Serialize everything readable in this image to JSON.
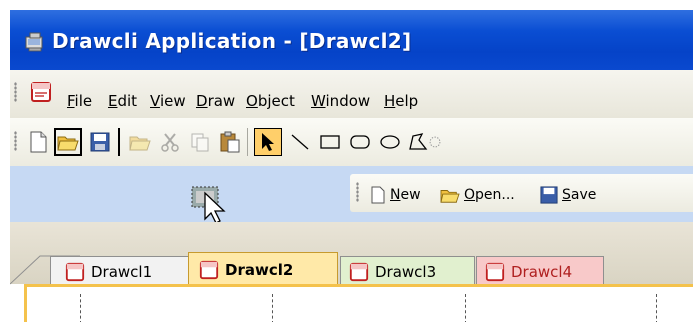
{
  "window": {
    "title": "Drawcli Application - [Drawcl2]"
  },
  "menubar": {
    "items": [
      {
        "label": "File",
        "mnemonic": "F",
        "rest": "ile"
      },
      {
        "label": "Edit",
        "mnemonic": "E",
        "rest": "dit"
      },
      {
        "label": "View",
        "mnemonic": "V",
        "rest": "iew"
      },
      {
        "label": "Draw",
        "mnemonic": "D",
        "rest": "raw"
      },
      {
        "label": "Object",
        "mnemonic": "O",
        "rest": "bject"
      },
      {
        "label": "Window",
        "mnemonic": "W",
        "rest": "indow"
      },
      {
        "label": "Help",
        "mnemonic": "H",
        "rest": "elp"
      }
    ]
  },
  "toolbar": {
    "buttons": [
      "new-icon",
      "open-icon",
      "save-icon",
      "open-icon",
      "cut-icon",
      "copy-icon",
      "paste-icon",
      "select-arrow-icon",
      "line-icon",
      "rectangle-icon",
      "rounded-rectangle-icon",
      "ellipse-icon",
      "polygon-icon"
    ]
  },
  "toolbar2": {
    "new": {
      "mnemonic": "N",
      "rest": "ew"
    },
    "open": {
      "mnemonic": "O",
      "rest": "pen..."
    },
    "save": {
      "mnemonic": "S",
      "rest": "ave"
    }
  },
  "tabs": [
    {
      "label": "Drawcl1",
      "active": false,
      "color": "#f2f2f2"
    },
    {
      "label": "Drawcl2",
      "active": true,
      "color": "#ffe9a8"
    },
    {
      "label": "Drawcl3",
      "active": false,
      "color": "#e1f0cf"
    },
    {
      "label": "Drawcl4",
      "active": false,
      "color": "#f8c9c9"
    }
  ],
  "colors": {
    "titlebar": "#0543c8",
    "accent": "#f4c24c",
    "toolbar_area": "#c6d9f3"
  }
}
